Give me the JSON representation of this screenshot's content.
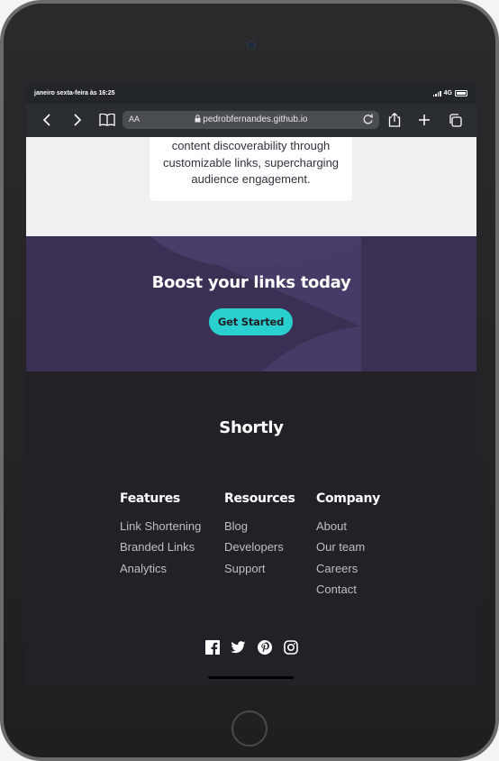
{
  "status_bar": {
    "time": "janeiro sexta-feira às 16:25",
    "network": "4G"
  },
  "browser": {
    "text_size": "AA",
    "url": "pedrobfernandes.github.io"
  },
  "intro_card": {
    "line1": "content discoverability through",
    "line2": "customizable links, supercharging",
    "line3": "audience engagement."
  },
  "boost": {
    "title": "Boost your links today",
    "cta": "Get Started"
  },
  "footer": {
    "logo": "Shortly",
    "features": {
      "title": "Features",
      "items": [
        "Link Shortening",
        "Branded Links",
        "Analytics"
      ]
    },
    "resources": {
      "title": "Resources",
      "items": [
        "Blog",
        "Developers",
        "Support"
      ]
    },
    "company": {
      "title": "Company",
      "items": [
        "About",
        "Our team",
        "Careers",
        "Contact"
      ]
    },
    "social": [
      "facebook-icon",
      "twitter-icon",
      "pinterest-icon",
      "instagram-icon"
    ]
  },
  "colors": {
    "primary": "#2acfcf",
    "dark_violet": "#3b3054",
    "footer_bg": "#232127"
  }
}
